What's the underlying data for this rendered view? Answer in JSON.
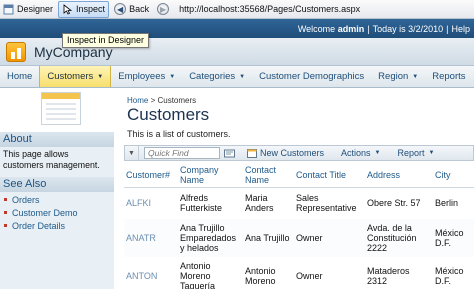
{
  "browser": {
    "designer_label": "Designer",
    "inspect_label": "Inspect",
    "back_label": "Back",
    "url": "http://localhost:35568/Pages/Customers.aspx",
    "tooltip": "Inspect in Designer"
  },
  "topbar": {
    "welcome_prefix": "Welcome ",
    "user": "admin",
    "date": "Today is 3/2/2010",
    "help": "Help"
  },
  "header": {
    "company": "MyCompany"
  },
  "menu": [
    {
      "label": "Home",
      "dropdown": false
    },
    {
      "label": "Customers",
      "dropdown": true,
      "selected": true
    },
    {
      "label": "Employees",
      "dropdown": true
    },
    {
      "label": "Categories",
      "dropdown": true
    },
    {
      "label": "Customer Demographics",
      "dropdown": false
    },
    {
      "label": "Region",
      "dropdown": true
    },
    {
      "label": "Reports",
      "dropdown": false
    }
  ],
  "sidebar": {
    "about_title": "About",
    "about_text": "This page allows customers management.",
    "seealso_title": "See Also",
    "links": [
      "Orders",
      "Customer Demo",
      "Order Details"
    ]
  },
  "main": {
    "breadcrumb_home": "Home",
    "breadcrumb_sep": ">",
    "breadcrumb_current": "Customers",
    "title": "Customers",
    "description": "This is a list of customers."
  },
  "actionbar": {
    "quickfind_placeholder": "Quick Find",
    "new_label": "New Customers",
    "actions_label": "Actions",
    "report_label": "Report"
  },
  "grid": {
    "columns": [
      "Customer#",
      "Company Name",
      "Contact Name",
      "Contact Title",
      "Address",
      "City"
    ],
    "rows": [
      [
        "ALFKI",
        "Alfreds Futterkiste",
        "Maria Anders",
        "Sales Representative",
        "Obere Str. 57",
        "Berlin"
      ],
      [
        "ANATR",
        "Ana Trujillo Emparedados y helados",
        "Ana Trujillo",
        "Owner",
        "Avda. de la Constitución 2222",
        "México D.F."
      ],
      [
        "ANTON",
        "Antonio Moreno Taquería",
        "Antonio Moreno",
        "Owner",
        "Mataderos 2312",
        "México D.F."
      ]
    ]
  },
  "colors": {
    "header_blue": "#1f4d7a",
    "link_blue": "#1f5a8a",
    "menu_selected": "#f7df6c",
    "logo_orange": "#f29500"
  }
}
